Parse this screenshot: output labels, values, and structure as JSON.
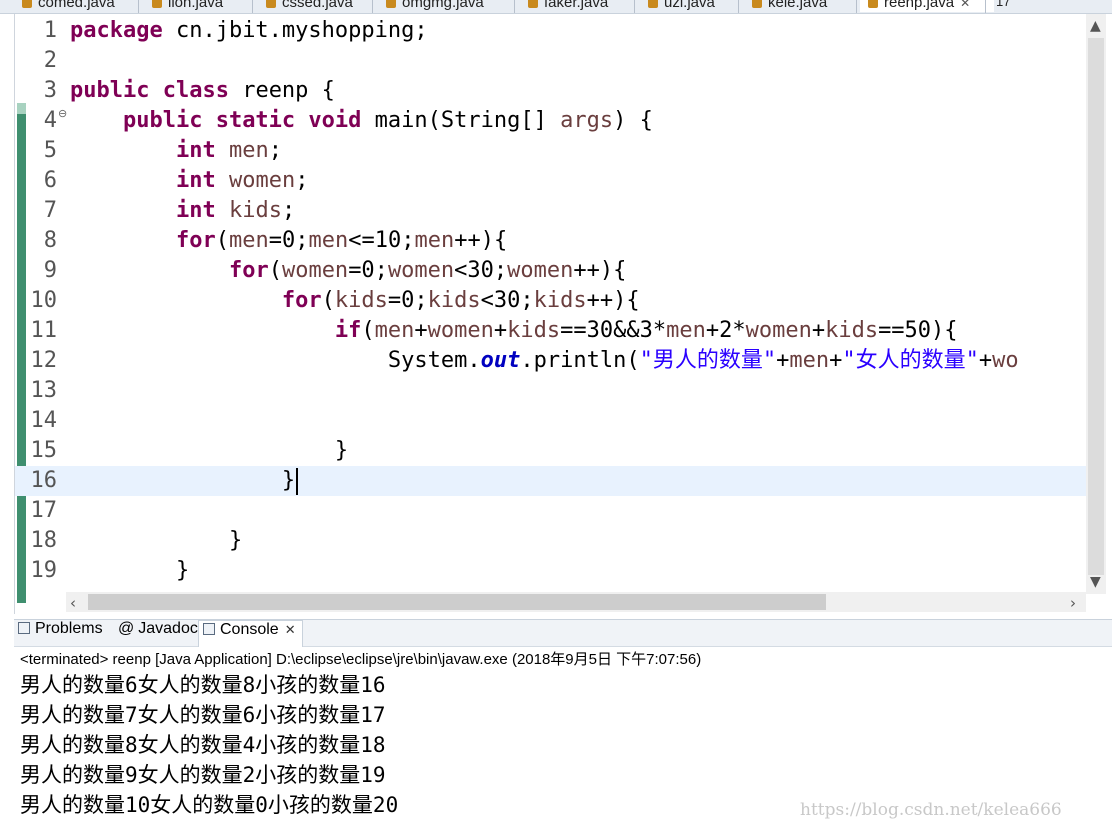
{
  "editor_tabs": [
    {
      "label": "comed.java"
    },
    {
      "label": "lion.java"
    },
    {
      "label": "cssed.java"
    },
    {
      "label": "omgmg.java"
    },
    {
      "label": "faker.java"
    },
    {
      "label": "uzi.java"
    },
    {
      "label": "kele.java"
    },
    {
      "label": "reenp.java",
      "active": true,
      "close_icon": "close-icon"
    },
    {
      "label": "17",
      "overflow": true
    }
  ],
  "code_lines": [
    {
      "num": "1"
    },
    {
      "num": "2"
    },
    {
      "num": "3"
    },
    {
      "num": "4",
      "fold": "⊖"
    },
    {
      "num": "5"
    },
    {
      "num": "6"
    },
    {
      "num": "7"
    },
    {
      "num": "8"
    },
    {
      "num": "9"
    },
    {
      "num": "10"
    },
    {
      "num": "11"
    },
    {
      "num": "12"
    },
    {
      "num": "13"
    },
    {
      "num": "14"
    },
    {
      "num": "15"
    },
    {
      "num": "16"
    },
    {
      "num": "17"
    },
    {
      "num": "18"
    },
    {
      "num": "19"
    }
  ],
  "code": {
    "l1": {
      "kw": "package",
      "rest": " cn.jbit.myshopping;"
    },
    "l3": {
      "kw": "public class",
      "rest": " reenp {"
    },
    "l4": {
      "kw": "public static void",
      "rest": " main(String[] ",
      "var": "args",
      "end": ") {"
    },
    "l5": {
      "kw": "int",
      "var": " men",
      "end": ";"
    },
    "l6": {
      "kw": "int",
      "var": " women",
      "end": ";"
    },
    "l7": {
      "kw": "int",
      "var": " kids",
      "end": ";"
    },
    "l8": {
      "kw": "for",
      "a": "(",
      "v1": "men",
      "b": "=0;",
      "v2": "men",
      "c": "<=10;",
      "v3": "men",
      "d": "++){"
    },
    "l9": {
      "kw": "for",
      "a": "(",
      "v1": "women",
      "b": "=0;",
      "v2": "women",
      "c": "<30;",
      "v3": "women",
      "d": "++){"
    },
    "l10": {
      "kw": "for",
      "a": "(",
      "v1": "kids",
      "b": "=0;",
      "v2": "kids",
      "c": "<30;",
      "v3": "kids",
      "d": "++){"
    },
    "l11": {
      "kw": "if",
      "a": "(",
      "v1": "men",
      "b": "+",
      "v2": "women",
      "c": "+",
      "v3": "kids",
      "d": "==30&&3*",
      "v4": "men",
      "e": "+2*",
      "v5": "women",
      "f": "+",
      "v6": "kids",
      "g": "==50){"
    },
    "l12": {
      "a": "System.",
      "field": "out",
      "b": ".println(",
      "s1": "\"男人的数量\"",
      "c": "+",
      "v1": "men",
      "d": "+",
      "s2": "\"女人的数量\"",
      "e": "+",
      "v2": "wo"
    },
    "l15": "}",
    "l16": "}",
    "l18": "}",
    "l19": "}"
  },
  "views": {
    "tabs": [
      {
        "label": "Problems",
        "icon": "problems-icon"
      },
      {
        "label": "Javadoc",
        "icon": "at-icon"
      },
      {
        "label": "Console",
        "icon": "console-icon",
        "active": true
      }
    ],
    "status": "<terminated> reenp [Java Application] D:\\eclipse\\eclipse\\jre\\bin\\javaw.exe (2018年9月5日 下午7:07:56)",
    "output": [
      "男人的数量6女人的数量8小孩的数量16",
      "男人的数量7女人的数量6小孩的数量17",
      "男人的数量8女人的数量4小孩的数量18",
      "男人的数量9女人的数量2小孩的数量19",
      "男人的数量10女人的数量0小孩的数量20"
    ]
  },
  "watermark": "https://blog.csdn.net/kelea666",
  "colors": {
    "keyword": "#7f0055",
    "variable": "#6a3e3e",
    "string": "#2a00ff",
    "field": "#0000c0",
    "current_line": "#e8f2fe",
    "change_bar": "#3f8f6f"
  }
}
